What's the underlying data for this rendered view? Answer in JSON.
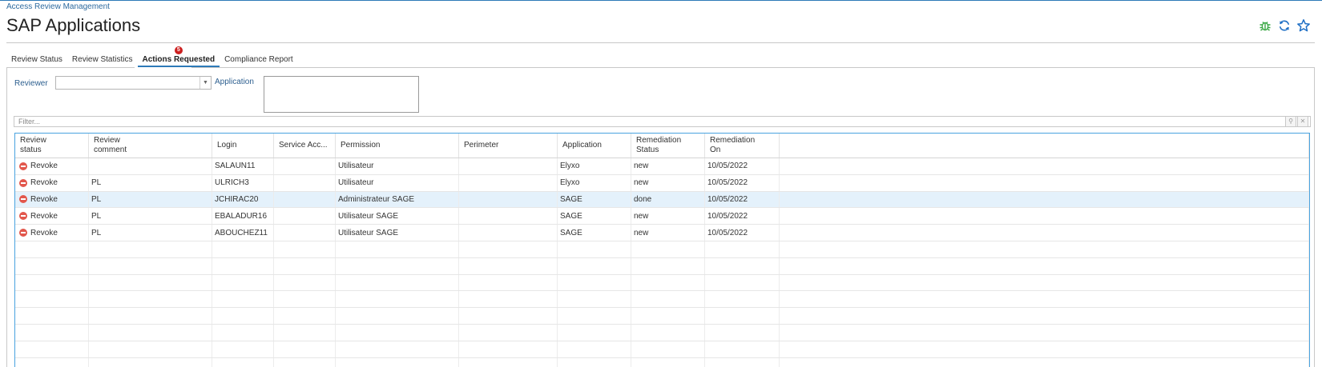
{
  "header": {
    "breadcrumb": "Access Review Management",
    "title": "SAP Applications",
    "icons": [
      "bug-icon",
      "refresh-icon",
      "star-icon"
    ]
  },
  "tabs": [
    {
      "label": "Review Status",
      "active": false
    },
    {
      "label": "Review Statistics",
      "active": false
    },
    {
      "label": "Actions Requested",
      "active": true,
      "badge": "5"
    },
    {
      "label": "Compliance Report",
      "active": false
    }
  ],
  "filters": {
    "reviewer_label": "Reviewer",
    "reviewer_value": "",
    "application_label": "Application",
    "application_value": ""
  },
  "filter_bar": {
    "placeholder": "Filter..."
  },
  "grid": {
    "columns": [
      [
        "Review",
        "status"
      ],
      [
        "Review",
        "comment"
      ],
      [
        "Login"
      ],
      [
        "Service Acc..."
      ],
      [
        "Permission"
      ],
      [
        "Perimeter"
      ],
      [
        "Application"
      ],
      [
        "Remediation",
        "Status"
      ],
      [
        "Remediation",
        "On"
      ],
      [
        ""
      ]
    ],
    "rows": [
      {
        "status": "Revoke",
        "comment": "",
        "login": "SALAUN11",
        "service": "",
        "permission": "Utilisateur",
        "perimeter": "",
        "application": "Elyxo",
        "remediation_status": "new",
        "remediation_on": "10/05/2022",
        "selected": false
      },
      {
        "status": "Revoke",
        "comment": "PL",
        "login": "ULRICH3",
        "service": "",
        "permission": "Utilisateur",
        "perimeter": "",
        "application": "Elyxo",
        "remediation_status": "new",
        "remediation_on": "10/05/2022",
        "selected": false
      },
      {
        "status": "Revoke",
        "comment": "PL",
        "login": "JCHIRAC20",
        "service": "",
        "permission": "Administrateur SAGE",
        "perimeter": "",
        "application": "SAGE",
        "remediation_status": "done",
        "remediation_on": "10/05/2022",
        "selected": true
      },
      {
        "status": "Revoke",
        "comment": "PL",
        "login": "EBALADUR16",
        "service": "",
        "permission": "Utilisateur SAGE",
        "perimeter": "",
        "application": "SAGE",
        "remediation_status": "new",
        "remediation_on": "10/05/2022",
        "selected": false
      },
      {
        "status": "Revoke",
        "comment": "PL",
        "login": "ABOUCHEZ11",
        "service": "",
        "permission": "Utilisateur SAGE",
        "perimeter": "",
        "application": "SAGE",
        "remediation_status": "new",
        "remediation_on": "10/05/2022",
        "selected": false
      }
    ],
    "status_icon": "revoke-icon"
  },
  "colors": {
    "accent": "#2d7ab8",
    "grid_border": "#4aa3df",
    "badge": "#cc1f1f",
    "revoke": "#e2574c",
    "selected_row": "#e4f1fb",
    "bug_icon": "#3aa845",
    "action_icon": "#1f6fc5"
  }
}
